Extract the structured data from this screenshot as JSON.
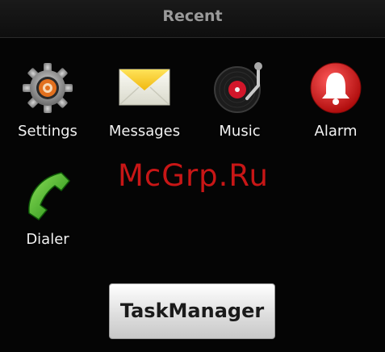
{
  "header": {
    "title": "Recent"
  },
  "apps": [
    {
      "label": "Settings",
      "icon": "settings-icon"
    },
    {
      "label": "Messages",
      "icon": "messages-icon"
    },
    {
      "label": "Music",
      "icon": "music-icon"
    },
    {
      "label": "Alarm",
      "icon": "alarm-icon"
    },
    {
      "label": "Dialer",
      "icon": "dialer-icon"
    }
  ],
  "watermark": "McGrp.Ru",
  "task_manager": {
    "label": "TaskManager"
  },
  "colors": {
    "background": "#050505",
    "label": "#f2f2f2",
    "header_text": "#9a9a9a",
    "watermark": "#c81616"
  }
}
